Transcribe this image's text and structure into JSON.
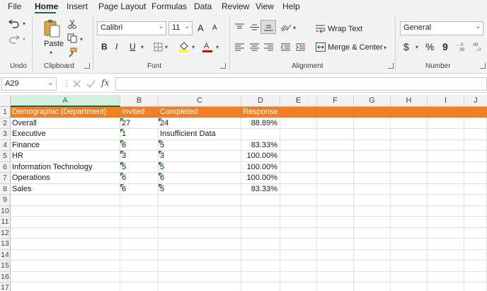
{
  "menu": {
    "tabs": [
      "File",
      "Home",
      "Insert",
      "Page Layout",
      "Formulas",
      "Data",
      "Review",
      "View",
      "Help"
    ],
    "active_tab": "Home"
  },
  "ribbon": {
    "groups": {
      "undo": "Undo",
      "clipboard": "Clipboard",
      "font": "Font",
      "alignment": "Alignment",
      "number": "Number"
    },
    "paste_label": "Paste",
    "font_name": "Calibri",
    "font_size": "11",
    "wrap_text": "Wrap Text",
    "merge_center": "Merge & Center",
    "number_format": "General",
    "bold": "B",
    "italic": "I",
    "underline": "U",
    "currency": "$",
    "percent": "%",
    "comma": "9",
    "grow_font": "A",
    "shrink_font": "A"
  },
  "formula_bar": {
    "name_box": "A29",
    "fx": "fx",
    "formula": ""
  },
  "sheet": {
    "columns": [
      "A",
      "B",
      "C",
      "D",
      "E",
      "F",
      "G",
      "H",
      "I",
      "J"
    ],
    "selected_column": "A",
    "row_numbers": [
      "1",
      "2",
      "3",
      "4",
      "5",
      "6",
      "7",
      "8",
      "9",
      "10",
      "11",
      "12",
      "13",
      "14",
      "15",
      "16",
      "17"
    ],
    "header": [
      "Demographic (Department)",
      "Invited",
      "Completed",
      "Response Rate"
    ],
    "rows": [
      [
        "Overall",
        "27",
        "24",
        "88.89%"
      ],
      [
        "Executive",
        "1",
        "Insufficient Data",
        ""
      ],
      [
        "Finance",
        "6",
        "5",
        "83.33%"
      ],
      [
        "HR",
        "3",
        "3",
        "100.00%"
      ],
      [
        "Information Technology",
        "5",
        "5",
        "100.00%"
      ],
      [
        "Operations",
        "6",
        "6",
        "100.00%"
      ],
      [
        "Sales",
        "6",
        "5",
        "83.33%"
      ]
    ]
  },
  "colors": {
    "header_fill": "#f07f24",
    "accent": "#1e6c41",
    "error_triangle": "#1d8c3a"
  }
}
